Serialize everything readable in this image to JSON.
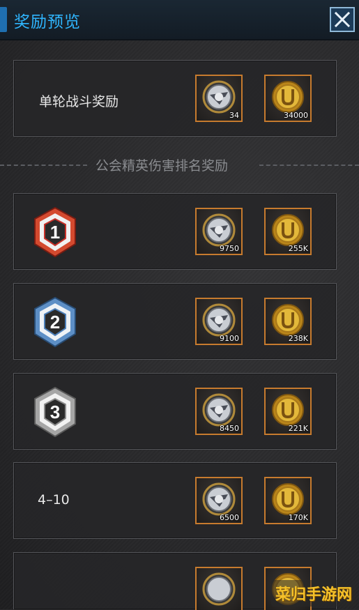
{
  "header": {
    "title": "奖励预览",
    "close_icon": "close-icon"
  },
  "single_battle": {
    "label": "单轮战斗奖励",
    "rewards": [
      {
        "icon": "shield-coin-icon",
        "qty": "34"
      },
      {
        "icon": "gold-coin-icon",
        "qty": "34000"
      }
    ]
  },
  "divider": {
    "text": "公会精英伤害排名奖励"
  },
  "ranks": [
    {
      "badge": "rank-1-badge",
      "badge_number": "1",
      "badge_color": "#c8322a",
      "rewards": [
        {
          "icon": "shield-coin-icon",
          "qty": "9750"
        },
        {
          "icon": "gold-coin-icon",
          "qty": "255K"
        }
      ]
    },
    {
      "badge": "rank-2-badge",
      "badge_number": "2",
      "badge_color": "#4d7fb8",
      "rewards": [
        {
          "icon": "shield-coin-icon",
          "qty": "9100"
        },
        {
          "icon": "gold-coin-icon",
          "qty": "238K"
        }
      ]
    },
    {
      "badge": "rank-3-badge",
      "badge_number": "3",
      "badge_color": "#8c8c8c",
      "rewards": [
        {
          "icon": "shield-coin-icon",
          "qty": "8450"
        },
        {
          "icon": "gold-coin-icon",
          "qty": "221K"
        }
      ]
    },
    {
      "label": "4–10",
      "rewards": [
        {
          "icon": "shield-coin-icon",
          "qty": "6500"
        },
        {
          "icon": "gold-coin-icon",
          "qty": "170K"
        }
      ]
    }
  ],
  "watermark": "菜归手游网",
  "colors": {
    "accent": "#2fb6ff",
    "item_border": "#c77b2e",
    "gold": "#d6a52a"
  }
}
